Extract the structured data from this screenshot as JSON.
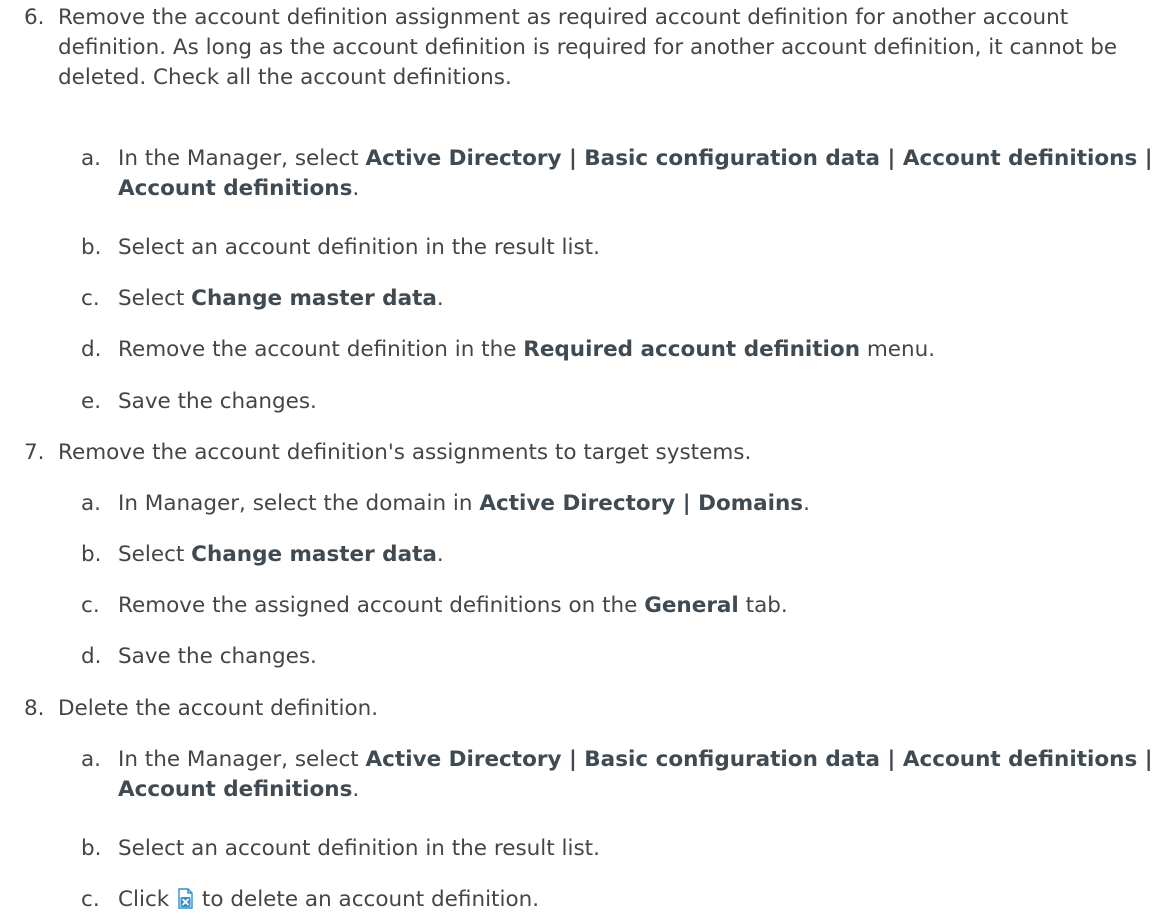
{
  "steps": {
    "s6": {
      "num": "6.",
      "text": "Remove the account definition assignment as required account definition for another account definition. As long as the account definition is required for another account definition, it cannot be deleted. Check all the account definitions.",
      "subs": {
        "a": {
          "num": "a.",
          "pre": "In the Manager, select ",
          "bold": "Active Directory | Basic configuration data | Account definitions | Account definitions",
          "post": "."
        },
        "b": {
          "num": "b.",
          "text": "Select an account definition in the result list."
        },
        "c": {
          "num": "c.",
          "pre": "Select ",
          "bold": "Change master data",
          "post": "."
        },
        "d": {
          "num": "d.",
          "pre": "Remove the account definition in the ",
          "bold": "Required account definition",
          "post": " menu."
        },
        "e": {
          "num": "e.",
          "text": "Save the changes."
        }
      }
    },
    "s7": {
      "num": "7.",
      "text": "Remove the account definition's assignments to target systems.",
      "subs": {
        "a": {
          "num": "a.",
          "pre": "In Manager, select the domain in ",
          "bold": "Active Directory | Domains",
          "post": "."
        },
        "b": {
          "num": "b.",
          "pre": "Select ",
          "bold": "Change master data",
          "post": "."
        },
        "c": {
          "num": "c.",
          "pre": "Remove the assigned account definitions on the ",
          "bold": "General",
          "post": " tab."
        },
        "d": {
          "num": "d.",
          "text": "Save the changes."
        }
      }
    },
    "s8": {
      "num": "8.",
      "text": "Delete the account definition.",
      "subs": {
        "a": {
          "num": "a.",
          "pre": "In the Manager, select ",
          "bold": "Active Directory | Basic configuration data | Account definitions | Account definitions",
          "post": "."
        },
        "b": {
          "num": "b.",
          "text": "Select an account definition in the result list."
        },
        "c": {
          "num": "c.",
          "pre": "Click ",
          "icon": "delete-icon",
          "post": " to delete an account definition."
        }
      }
    }
  },
  "colors": {
    "text": "#454545",
    "bold": "#3f4a52",
    "icon_blue": "#2f8fd0"
  }
}
